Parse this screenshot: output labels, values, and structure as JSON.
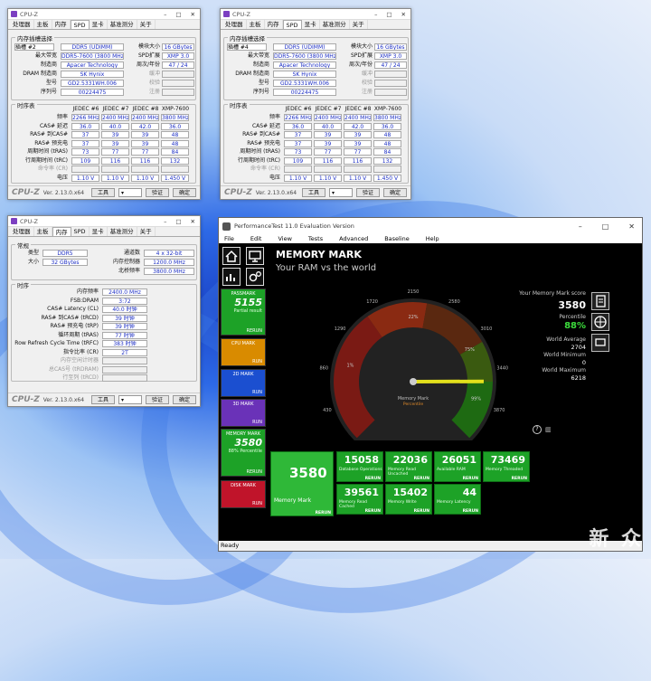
{
  "cpuz": {
    "title": "CPU-Z",
    "spd_tabs": [
      "处理器",
      "主板",
      "内存",
      "SPD",
      "显卡",
      "基准测分",
      "关于"
    ],
    "slot_group": "内存插槽选择",
    "slot1": "插槽 #2",
    "slot2": "插槽 #4",
    "spd_labels_left": [
      "最大带宽",
      "制造商",
      "DRAM 制造商",
      "型号",
      "序列号"
    ],
    "spd_values": [
      "DDR5 (UDIMM)",
      "DDR5-7600 (3800 MHz)",
      "Apacer Technology",
      "SK Hynix",
      "GD2.5331WH.006",
      "00224475"
    ],
    "spd_labels_right": [
      "模块大小",
      "SPD扩展",
      "周次/年份",
      "缓冲",
      "校验",
      "注册"
    ],
    "spd_right_values": [
      "16 GBytes",
      "XMP 3.0",
      "47 / 24"
    ],
    "timing_group": "时序表",
    "timing_cols": [
      "JEDEC #6",
      "JEDEC #7",
      "JEDEC #8",
      "XMP-7600"
    ],
    "timing_labels": [
      "频率",
      "CAS# 延迟",
      "RAS# 到CAS#",
      "RAS# 预充电",
      "周期时间 (tRAS)",
      "行周期时间 (tRC)",
      "命令率 (CR)",
      "电压"
    ],
    "timing_rows": [
      [
        "2266 MHz",
        "2400 MHz",
        "2400 MHz",
        "3800 MHz"
      ],
      [
        "36.0",
        "40.0",
        "42.0",
        "36.0"
      ],
      [
        "37",
        "39",
        "39",
        "48"
      ],
      [
        "37",
        "39",
        "39",
        "48"
      ],
      [
        "73",
        "77",
        "77",
        "84"
      ],
      [
        "109",
        "116",
        "116",
        "132"
      ],
      [
        "",
        "",
        "",
        ""
      ],
      [
        "1.10 V",
        "1.10 V",
        "1.10 V",
        "1.450 V"
      ]
    ],
    "brand": "CPU-Z",
    "version": "Ver. 2.13.0.x64",
    "tools": "工具",
    "verify": "验证",
    "ok": "确定",
    "mem_tabs": [
      "处理器",
      "主板",
      "内存",
      "SPD",
      "显卡",
      "基准测分",
      "关于"
    ],
    "general_group": "常规",
    "gen_labels": [
      "类型",
      "大小"
    ],
    "gen_values": [
      "DDR5",
      "32 GBytes"
    ],
    "gen_labels_r": [
      "通道数",
      "内存控制器",
      "北桥频率"
    ],
    "gen_values_r": [
      "4 x 32-bit",
      "1200.0 MHz",
      "3800.0 MHz"
    ],
    "mt_group": "时序",
    "mt_labels": [
      "内存频率",
      "FSB:DRAM",
      "CAS# Latency (CL)",
      "RAS# 到CAS# (tRCD)",
      "RAS# 预充电 (tRP)",
      "循环周期 (tRAS)",
      "Row Refresh Cycle Time (tRFC)",
      "指令比率 (CR)",
      "内存空闲计时器",
      "总CAS号 (tRDRAM)",
      "行至列 (tRCD)"
    ],
    "mt_values": [
      "2400.0 MHz",
      "3:72",
      "40.0 时钟",
      "39 时钟",
      "39 时钟",
      "77 时钟",
      "383 时钟",
      "2T"
    ]
  },
  "pt": {
    "title": "PerformanceTest 11.0 Evaluation Version",
    "menu": [
      "File",
      "Edit",
      "View",
      "Tests",
      "Advanced",
      "Baseline",
      "Help"
    ],
    "heading": "MEMORY MARK",
    "subheading": "Your RAM vs the world",
    "sidebar": [
      {
        "t": "PASSMARK",
        "v": "5155",
        "s": "Partial result",
        "r": "RERUN",
        "c": "#1da227"
      },
      {
        "t": "CPU MARK",
        "v": "",
        "s": "",
        "r": "RUN",
        "c": "#d98b00"
      },
      {
        "t": "2D MARK",
        "v": "",
        "s": "",
        "r": "RUN",
        "c": "#1b4fd0"
      },
      {
        "t": "3D MARK",
        "v": "",
        "s": "",
        "r": "RUN",
        "c": "#6a32b8"
      },
      {
        "t": "MEMORY MARK",
        "v": "3580",
        "s": "88% Percentile",
        "r": "RERUN",
        "c": "#1da227"
      },
      {
        "t": "DISK MARK",
        "v": "",
        "s": "",
        "r": "RUN",
        "c": "#c0142a"
      }
    ],
    "score_label": "Your Memory Mark score",
    "score": "3580",
    "pct_label": "Percentile",
    "pct": "88%",
    "stats": [
      {
        "l": "World Average",
        "v": "2704"
      },
      {
        "l": "World Minimum",
        "v": "0"
      },
      {
        "l": "World Maximum",
        "v": "6218"
      }
    ],
    "gauge_ticks": [
      "0",
      "430",
      "860",
      "1290",
      "1720",
      "2150",
      "2580",
      "3010",
      "3440",
      "3870",
      "4300"
    ],
    "gauge_pcts": [
      "1%",
      "22%",
      "75%",
      "99%"
    ],
    "gauge_name": "Memory Mark",
    "gauge_sub": "Percentile",
    "big_tile": {
      "v": "3580",
      "l": "Memory Mark",
      "r": "RERUN"
    },
    "tiles": [
      {
        "v": "15058",
        "l": "Database Operations",
        "r": "RERUN"
      },
      {
        "v": "22036",
        "l": "Memory Read Uncached",
        "r": "RERUN"
      },
      {
        "v": "26051",
        "l": "Available RAM",
        "r": "RERUN"
      },
      {
        "v": "73469",
        "l": "Memory Threaded",
        "r": "RERUN"
      },
      {
        "v": "39561",
        "l": "Memory Read Cached",
        "r": "RERUN"
      },
      {
        "v": "15402",
        "l": "Memory Write",
        "r": "RERUN"
      },
      {
        "v": "44",
        "l": "Memory Latency",
        "r": "RERUN"
      }
    ],
    "status": "Ready"
  },
  "watermark": "新 众"
}
